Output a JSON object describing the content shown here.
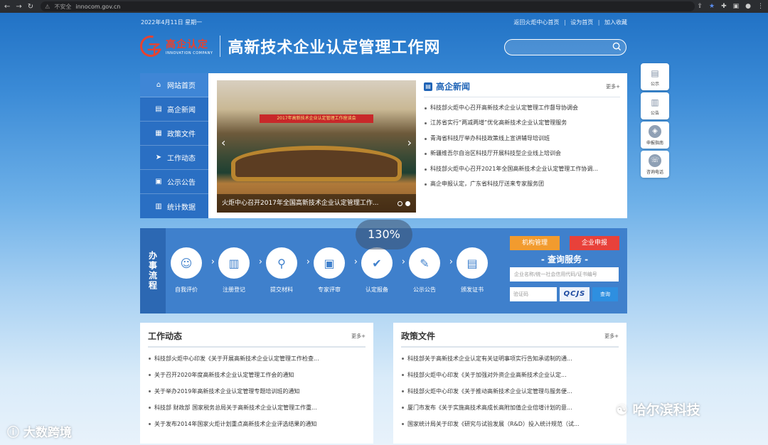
{
  "browser": {
    "security": "不安全",
    "url": "innocom.gov.cn"
  },
  "header": {
    "date": "2022年4月11日 星期一",
    "links": [
      "返回火炬中心首页",
      "设为首页",
      "加入收藏"
    ],
    "logo_cn": "高企认定",
    "logo_en": "INNOVATION COMPANY",
    "site_title": "高新技术企业认定管理工作网"
  },
  "side_tools": [
    {
      "label": "公示",
      "icon": "notice-board-icon"
    },
    {
      "label": "公告",
      "icon": "announcement-icon"
    },
    {
      "label": "申报指南",
      "icon": "compass-icon"
    },
    {
      "label": "咨询电话",
      "icon": "phone-icon"
    }
  ],
  "menu": [
    "网站首页",
    "高企新闻",
    "政策文件",
    "工作动态",
    "公示公告",
    "统计数据"
  ],
  "slider": {
    "banner_text": "2017年高新技术企业认定管理工作座谈会",
    "caption": "火炬中心召开2017年全国高新技术企业认定管理工作..."
  },
  "news": {
    "title": "高企新闻",
    "more": "更多+",
    "items": [
      "科技部火炬中心召开高新技术企业认定管理工作督导协调会",
      "江苏省实行“两减两增”优化高新技术企业认定管理服务",
      "青海省科技厅举办科技政策线上宣讲辅导培训班",
      "新疆维吾尔自治区科技厅开展科技型企业线上培训会",
      "科技部火炬中心召开2021年全国高新技术企业认定管理工作协调...",
      "高企申报认定，广东省科技厅送来专家服务团"
    ]
  },
  "process": {
    "title": "办事流程",
    "steps": [
      {
        "label": "自我评价",
        "icon": "user-check-icon"
      },
      {
        "label": "注册登记",
        "icon": "register-icon"
      },
      {
        "label": "提交材料",
        "icon": "submit-icon"
      },
      {
        "label": "专家评审",
        "icon": "review-icon"
      },
      {
        "label": "认定报备",
        "icon": "approve-icon"
      },
      {
        "label": "公示公告",
        "icon": "announce-icon"
      },
      {
        "label": "颁发证书",
        "icon": "certificate-icon"
      }
    ]
  },
  "zoom": "130%",
  "query": {
    "btn_manage": "机构管理",
    "btn_apply": "企业申报",
    "title": "- 查询服务 -",
    "placeholder": "企业名称/统一社会信用代码/证书编号",
    "code_placeholder": "验证码",
    "captcha": "QCJS",
    "go": "查询"
  },
  "work": {
    "title": "工作动态",
    "more": "更多+",
    "items": [
      "科技部火炬中心印发《关于开展高新技术企业认定管理工作检查...",
      "关于召开2020年度高新技术企业认定管理工作会的通知",
      "关于举办2019年高新技术企业认定管理专题培训班的通知",
      "科技部 财政部 国家税务总局关于高新技术企业认定管理工作重...",
      "关于发布2014年国家火炬计划重点高新技术企业评选结果的通知"
    ]
  },
  "policy": {
    "title": "政策文件",
    "more": "更多+",
    "items": [
      "科技部关于高新技术企业认定有关证明事项实行告知承诺制的通...",
      "科技部火炬中心印发《关于加强对外资企业高新技术企业认定...",
      "科技部火炬中心印发《关于推动高新技术企业认定管理与服务便...",
      "厦门市发布《关于实施高技术高成长高附加值企业倍增计划的意...",
      "国家统计局关于印发《研究与试验发展（R&D）投入统计规范（试..."
    ]
  },
  "watermarks": {
    "left": "大数跨境",
    "right": "哈尔滨科技"
  }
}
